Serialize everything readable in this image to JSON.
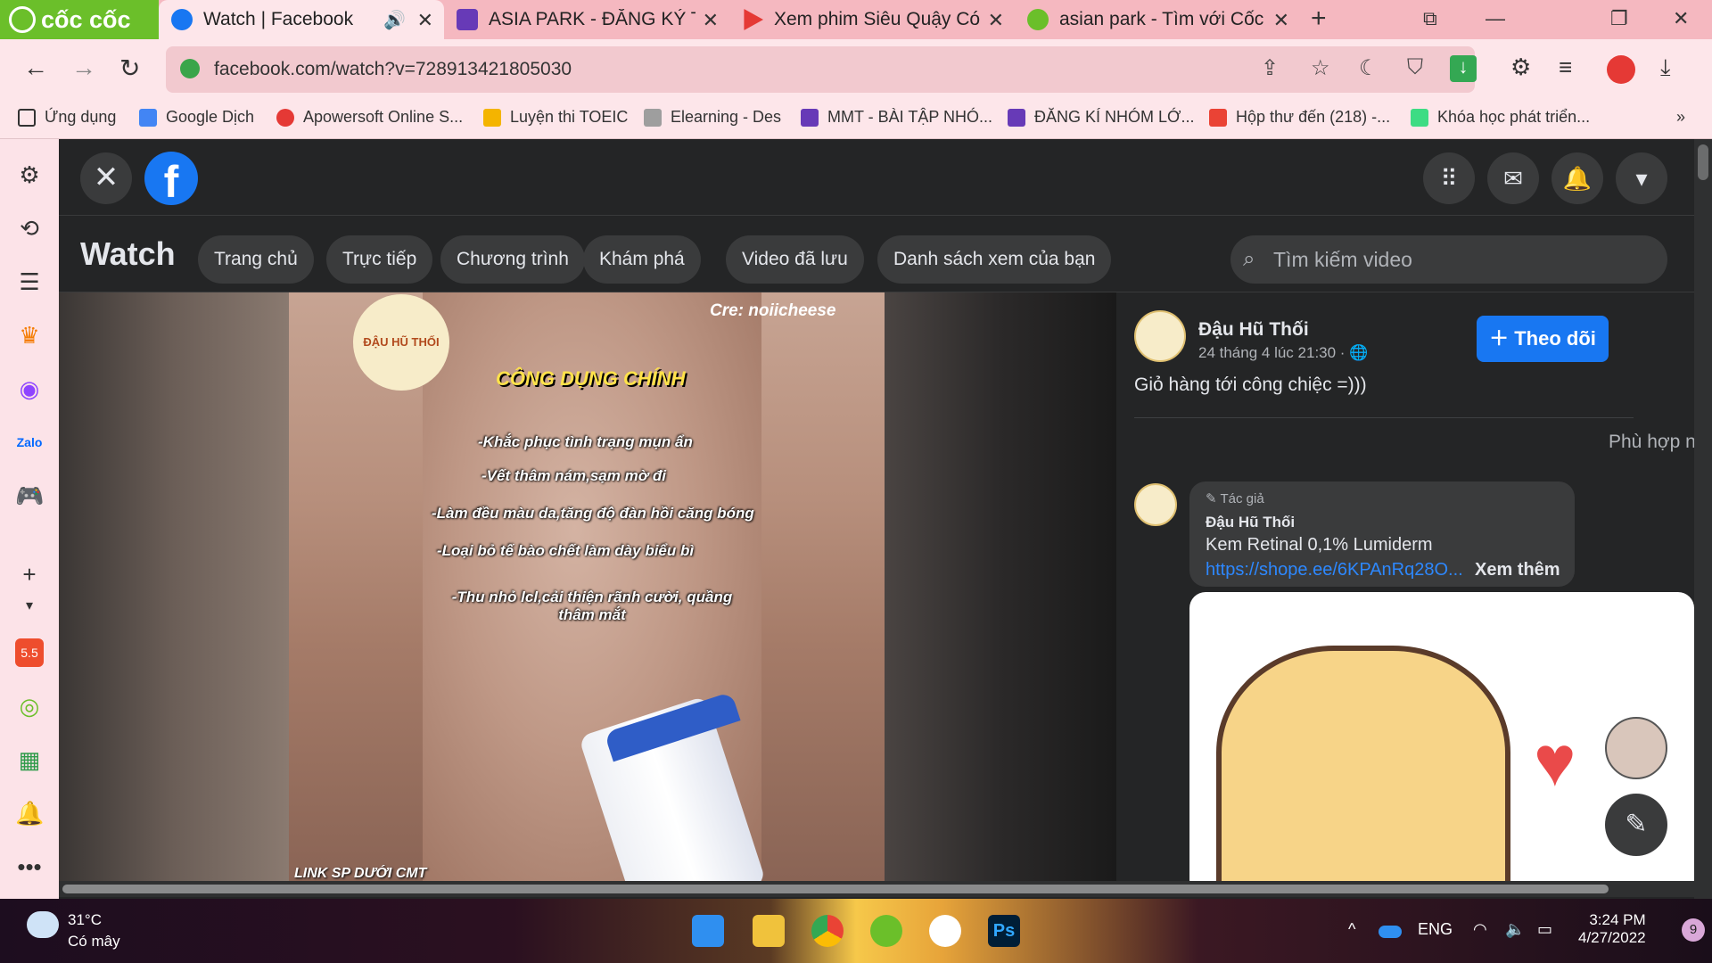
{
  "browser": {
    "brand": "cốc cốc",
    "tabs": [
      {
        "title": "Watch | Facebook",
        "icon": "facebook-icon",
        "active": true
      },
      {
        "title": "ASIA PARK - ĐĂNG KÝ TI",
        "icon": "forms-icon"
      },
      {
        "title": "Xem phim Siêu Quậy Có",
        "icon": "play-icon"
      },
      {
        "title": "asian park - Tìm với Cốc",
        "icon": "coccoc-icon"
      }
    ],
    "address": "facebook.com/watch?v=728913421805030",
    "bookmarks": [
      "Ứng dụng",
      "Google Dịch",
      "Apowersoft Online S...",
      "Luyện thi TOEIC",
      "Elearning - Des",
      "MMT - BÀI TẬP NHÓ...",
      "ĐĂNG KÍ NHÓM LỚ...",
      "Hộp thư đến (218) -...",
      "Khóa học phát triển..."
    ],
    "bookmarks_more": "»"
  },
  "fb": {
    "logo": "f",
    "watch_title": "Watch",
    "nav": [
      "Trang chủ",
      "Trực tiếp",
      "Chương trình",
      "Khám phá",
      "Video đã lưu",
      "Danh sách xem của bạn"
    ],
    "search_placeholder": "Tìm kiếm video"
  },
  "video": {
    "credit": "Cre: noiicheese",
    "logo_text": "ĐẬU HŨ THỐI",
    "heading": "CÔNG DỤNG CHÍNH",
    "lines": [
      "-Khắc phục tình trạng mụn ẩn",
      "-Vết thâm nám,sạm mờ đi",
      "-Làm đều màu da,tăng độ đàn hồi căng bóng",
      "-Loại bỏ tế bào chết làm dày biểu bì",
      "-Thu nhỏ lcl,cải thiện rãnh cười, quầng thâm mắt"
    ],
    "bottom_text": "LINK SP DƯỚI CMT"
  },
  "post": {
    "page_name": "Đậu Hũ Thối",
    "date": "24 tháng 4 lúc 21:30 ·",
    "follow_label": "Theo dõi",
    "caption": "Giỏ hàng tới công chiệc =)))",
    "sort_label": "Phù hợp nhất",
    "comment": {
      "tag": "Tác giả",
      "author": "Đậu Hũ Thối",
      "text": "Kem Retinal 0,1% Lumiderm",
      "link": "https://shope.ee/6KPAnRq28O...",
      "more": "Xem thêm"
    }
  },
  "taskbar": {
    "temp": "31°C",
    "condition": "Có mây",
    "lang": "ENG",
    "time": "3:24 PM",
    "date": "4/27/2022",
    "notif_count": "9"
  },
  "colors": {
    "tabbar": "#f5b8c0",
    "coccoc_green": "#6bbf2a",
    "fb_blue": "#1877f2",
    "fb_dark": "#242526",
    "fb_surface": "#3a3b3c",
    "fb_text": "#e4e6eb"
  }
}
